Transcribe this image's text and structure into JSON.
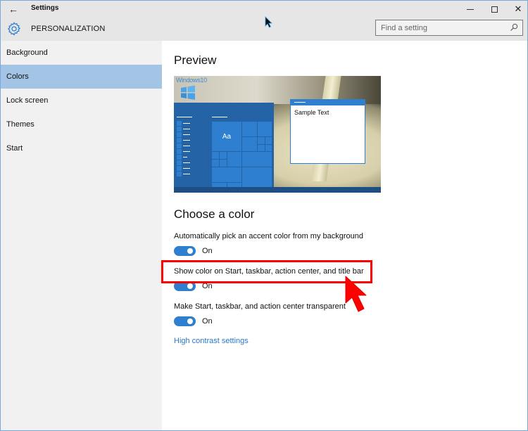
{
  "window": {
    "title": "Settings",
    "back_icon": "←",
    "controls": {
      "minimize": "minimize",
      "maximize": "maximize",
      "close": "✕"
    }
  },
  "header": {
    "title": "PERSONALIZATION",
    "icon": "gear-icon",
    "search": {
      "placeholder": "Find a setting",
      "value": ""
    }
  },
  "sidebar": {
    "items": [
      {
        "label": "Background",
        "active": false
      },
      {
        "label": "Colors",
        "active": true
      },
      {
        "label": "Lock screen",
        "active": false
      },
      {
        "label": "Themes",
        "active": false
      },
      {
        "label": "Start",
        "active": false
      }
    ]
  },
  "main": {
    "preview": {
      "heading": "Preview",
      "logo_text": "Windows10",
      "tile_label": "Aa",
      "sample_text": "Sample Text"
    },
    "choose_color": {
      "heading": "Choose a color",
      "settings": [
        {
          "label": "Automatically pick an accent color from my background",
          "state": "On",
          "enabled": true
        },
        {
          "label": "Show color on Start, taskbar, action center, and title bar",
          "state": "On",
          "enabled": true
        },
        {
          "label": "Make Start, taskbar, and action center transparent",
          "state": "On",
          "enabled": true
        }
      ],
      "link": "High contrast settings"
    }
  },
  "colors": {
    "accent": "#2f7fd1",
    "selected_nav": "#a3c4e4",
    "link": "#2a78c8",
    "annotation": "#ff0000"
  }
}
